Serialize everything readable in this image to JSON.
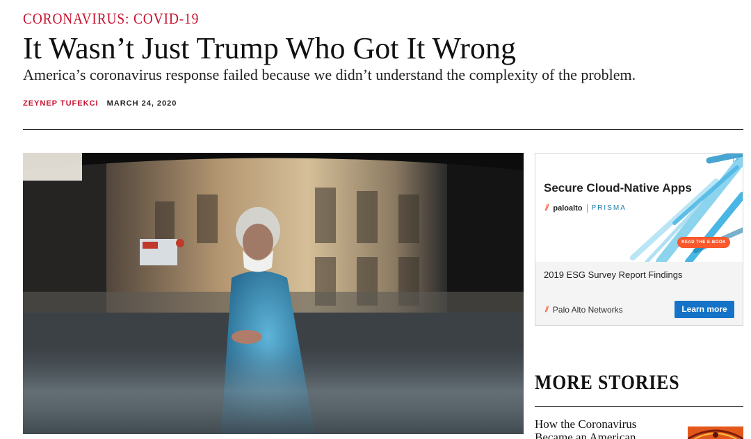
{
  "article": {
    "kicker": "CORONAVIRUS: COVID-19",
    "title": "It Wasn’t Just Trump Who Got It Wrong",
    "dek": "America’s coronavirus response failed because we didn’t understand the complexity of the problem.",
    "author": "ZEYNEP TUFEKCI",
    "date": "MARCH 24, 2020"
  },
  "ad": {
    "headline": "Secure Cloud-Native Apps",
    "brand_logo": "paloalto",
    "product_logo": "PRISMA",
    "small_cta": "READ THE E-BOOK",
    "description": "2019 ESG Survey Report Findings",
    "advertiser": "Palo Alto Networks",
    "button_label": "Learn more",
    "ad_choices_icon": "adchoices-triangle-icon",
    "accent_color": "#fa582d",
    "button_color": "#1473c6"
  },
  "sidebar": {
    "more_stories_title": "MORE STORIES",
    "stories": [
      {
        "title": "How the Coronavirus Became an American"
      }
    ]
  },
  "colors": {
    "kicker_red": "#c8102e",
    "rule": "#222222"
  }
}
